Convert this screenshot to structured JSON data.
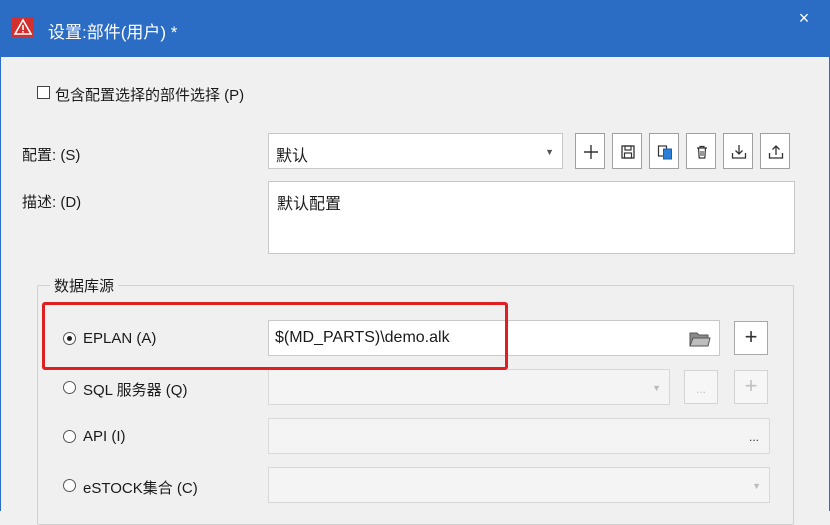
{
  "window": {
    "title": "设置:部件(用户) *",
    "close_glyph": "×",
    "accent_color": "#2b6cc4",
    "app_icon": "warning-triangle-icon"
  },
  "include_config_checkbox": {
    "label": "包含配置选择的部件选择 (P)",
    "checked": false
  },
  "config": {
    "label": "配置: (S)",
    "value": "默认",
    "toolbar": [
      "add-icon",
      "save-icon",
      "copy-icon",
      "delete-icon",
      "import-icon",
      "export-icon"
    ]
  },
  "description": {
    "label": "描述: (D)",
    "value": "默认配置"
  },
  "database_source": {
    "legend": "数据库源",
    "eplan": {
      "label": "EPLAN (A)",
      "selected": true,
      "value": "$(MD_PARTS)\\demo.alk",
      "add_label": "+"
    },
    "sql": {
      "label": "SQL 服务器 (Q)",
      "selected": false,
      "browse_label": "...",
      "add_label": "+"
    },
    "api": {
      "label": "API (I)",
      "selected": false,
      "browse_label": "..."
    },
    "estock": {
      "label": "eSTOCK集合 (C)",
      "selected": false
    }
  },
  "highlight_color": "#e02020"
}
